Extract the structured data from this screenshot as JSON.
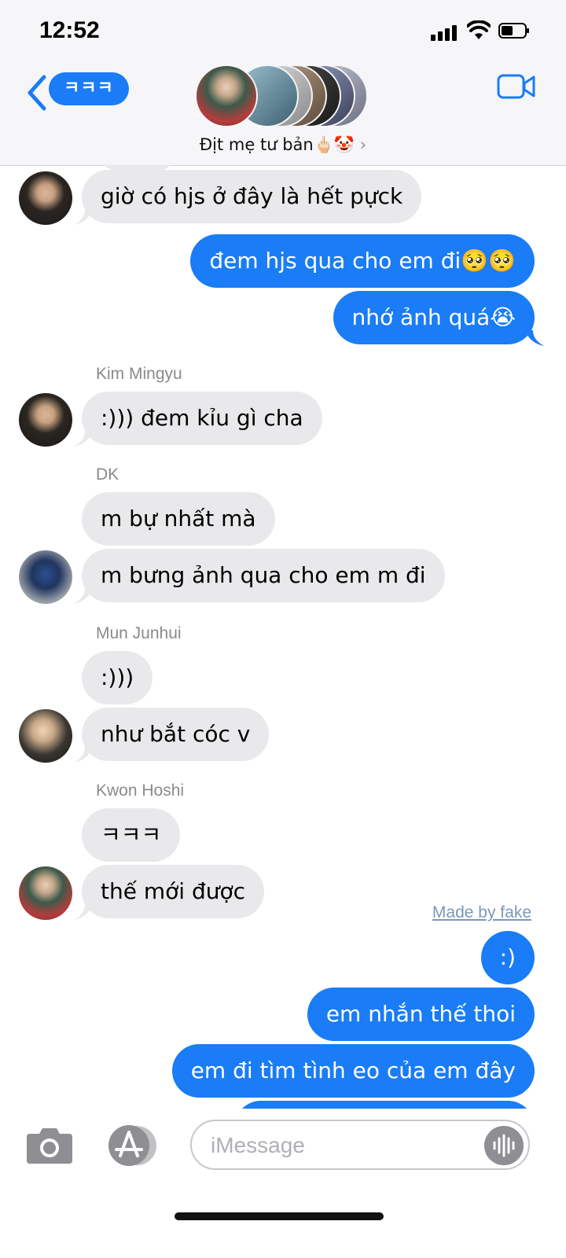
{
  "status": {
    "time": "12:52"
  },
  "header": {
    "back_label": "ㅋㅋㅋ",
    "group_name": "Địt mẹ tư bản🖕🏻🤡"
  },
  "messages": [
    {
      "side": "in",
      "text": "giờ có hjs ở đây là hết pựck"
    },
    {
      "side": "out",
      "text": "đem hjs qua cho em đi🥺🥺"
    },
    {
      "side": "out",
      "text": "nhớ ảnh quá😭"
    },
    {
      "sender": "Kim Mingyu",
      "side": "in",
      "text": ":))) đem kỉu gì cha"
    },
    {
      "sender": "DK",
      "side": "in",
      "text": "m bự nhất mà"
    },
    {
      "side": "in",
      "text": "m bưng ảnh qua cho em m đi"
    },
    {
      "sender": "Mun Junhui",
      "side": "in",
      "text": ":)))"
    },
    {
      "side": "in",
      "text": "như bắt cóc v"
    },
    {
      "sender": "Kwon Hoshi",
      "side": "in",
      "text": "ㅋㅋㅋ"
    },
    {
      "side": "in",
      "text": "thế mới được"
    },
    {
      "side": "out",
      "text": ":)"
    },
    {
      "side": "out",
      "text": "em nhắn thế thoi"
    },
    {
      "side": "out",
      "text": "em đi tìm tình eo của em đây"
    }
  ],
  "watermark": "Made by fake",
  "composer": {
    "placeholder": "iMessage"
  },
  "colors": {
    "accent": "#1a7cf6",
    "incoming": "#e9e9eb"
  },
  "icons": [
    "back-chevron-icon",
    "video-camera-icon",
    "camera-icon",
    "app-store-icon",
    "audio-wave-icon"
  ]
}
